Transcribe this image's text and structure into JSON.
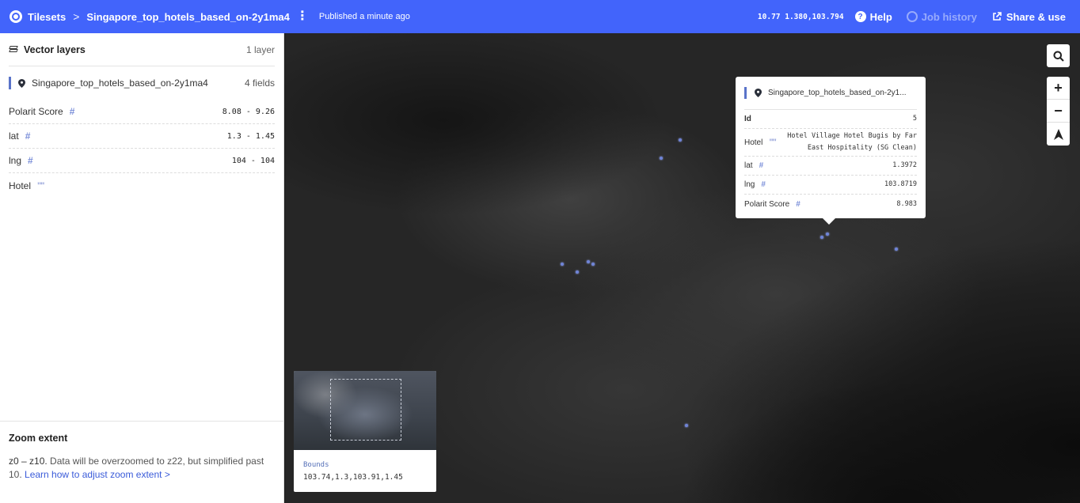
{
  "topbar": {
    "tilesets_label": "Tilesets",
    "separator": ">",
    "tileset_name": "Singapore_top_hotels_based_on-2y1ma4",
    "more_glyph": "⋮",
    "published": "Published a minute ago",
    "coords": "10.77 1.380,103.794",
    "help_label": "Help",
    "job_history_label": "Job history",
    "share_label": "Share & use"
  },
  "sidebar": {
    "title": "Vector layers",
    "layer_count": "1 layer",
    "layer": {
      "name": "Singapore_top_hotels_based_on-2y1ma4",
      "fields_count": "4 fields"
    },
    "fields": [
      {
        "name": "Polarit Score",
        "type": "#",
        "range": "8.08 - 9.26"
      },
      {
        "name": "lat",
        "type": "#",
        "range": "1.3 - 1.45"
      },
      {
        "name": "lng",
        "type": "#",
        "range": "104 - 104"
      },
      {
        "name": "Hotel",
        "type": "\"\"",
        "range": ""
      }
    ],
    "zoom": {
      "title": "Zoom extent",
      "range": "z0 – z10.",
      "text": " Data will be overzoomed to z22, but simplified past 10.",
      "link": "Learn how to adjust zoom extent",
      "link_arrow": ">"
    }
  },
  "popup": {
    "layer_name": "Singapore_top_hotels_based_on-2y1...",
    "rows": [
      {
        "key": "Id",
        "type": "",
        "value": "5"
      },
      {
        "key": "Hotel",
        "type": "\"\"",
        "value": "Hotel Village Hotel Bugis by Far East Hospitality (SG Clean)"
      },
      {
        "key": "lat",
        "type": "#",
        "value": "1.3972"
      },
      {
        "key": "lng",
        "type": "#",
        "value": "103.8719"
      },
      {
        "key": "Polarit Score",
        "type": "#",
        "value": "8.983"
      }
    ]
  },
  "map_controls": {
    "search": "search-icon",
    "zoom_in": "+",
    "zoom_out": "−",
    "compass": "▲"
  },
  "minimap": {
    "label": "Bounds",
    "value": "103.74,1.3,103.91,1.45"
  },
  "colors": {
    "brand": "#4264fb",
    "layer_accent": "#5973c9",
    "point": "#6f84d8"
  }
}
